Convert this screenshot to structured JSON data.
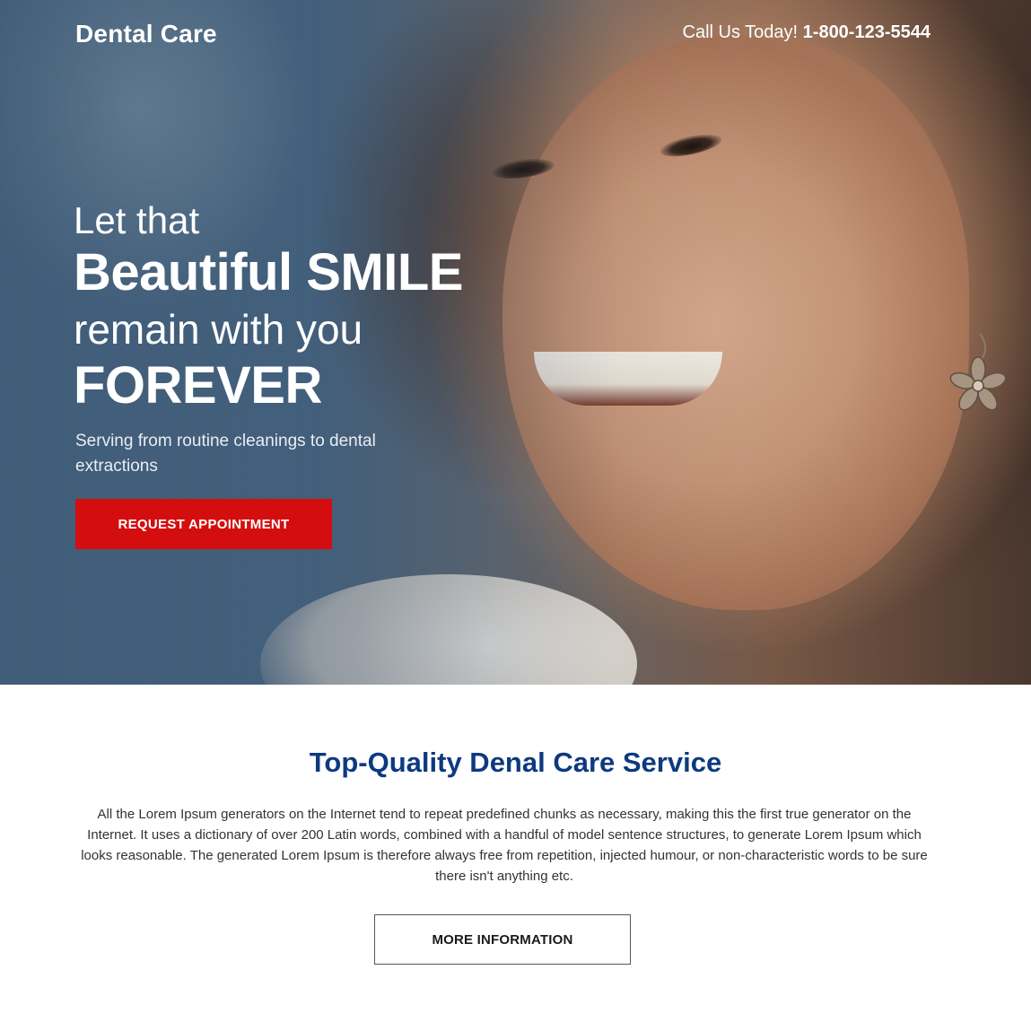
{
  "header": {
    "brand": "Dental Care",
    "call_label": "Call Us Today!",
    "phone": "1-800-123-5544"
  },
  "hero": {
    "headline_line1": "Let that",
    "headline_line2": "Beautiful SMILE",
    "headline_line3": "remain with you",
    "headline_line4": "FOREVER",
    "subtext": "Serving from routine cleanings to dental extractions",
    "cta_label": "REQUEST APPOINTMENT"
  },
  "content": {
    "title": "Top-Quality Denal Care Service",
    "body": "All the Lorem Ipsum generators on the Internet tend to repeat predefined chunks as necessary, making this the first true generator on the Internet. It uses a dictionary of over 200 Latin words, combined with a handful of model sentence structures, to generate Lorem Ipsum which looks reasonable. The generated Lorem Ipsum is therefore always free from repetition, injected humour, or non-characteristic words to be sure there isn't anything etc.",
    "more_label": "MORE INFORMATION"
  },
  "colors": {
    "cta_red": "#d40e0e",
    "title_blue": "#0d3a7f",
    "hero_overlay": "#1f4b73"
  }
}
